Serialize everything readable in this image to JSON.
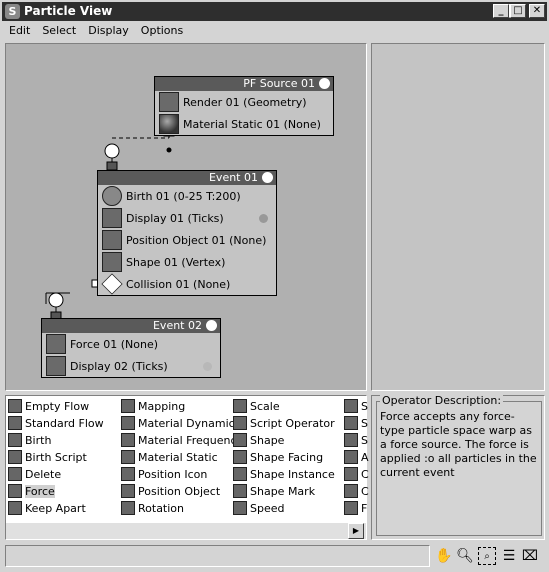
{
  "window": {
    "title": "Particle View"
  },
  "menu": [
    "Edit",
    "Select",
    "Display",
    "Options"
  ],
  "nodes": {
    "source": {
      "title": "PF Source 01",
      "rows": [
        "Render 01 (Geometry)",
        "Material Static 01 (None)"
      ]
    },
    "event1": {
      "title": "Event 01",
      "rows": [
        "Birth 01 (0-25 T:200)",
        "Display 01 (Ticks)",
        "Position Object 01 (None)",
        "Shape 01 (Vertex)",
        "Collision 01 (None)"
      ]
    },
    "event2": {
      "title": "Event 02",
      "rows": [
        "Force 01 (None)",
        "Display 02 (Ticks)"
      ]
    }
  },
  "depot": {
    "col1": [
      "Empty Flow",
      "Standard Flow",
      "Birth",
      "Birth Script",
      "Delete",
      "Force",
      "Keep Apart"
    ],
    "col2": [
      "Mapping",
      "Material Dynamic",
      "Material Frequency",
      "Material Static",
      "Position Icon",
      "Position Object",
      "Rotation"
    ],
    "col3": [
      "Scale",
      "Script Operator",
      "Shape",
      "Shape Facing",
      "Shape Instance",
      "Shape Mark",
      "Speed"
    ],
    "col4": [
      "S",
      "S",
      "S",
      "A",
      "C",
      "C",
      "F"
    ],
    "selected": "Force"
  },
  "description": {
    "label": "Operator Description:",
    "text": "Force accepts any force-type particle space warp as a force source. The force is applied :o all particles in the current event"
  },
  "tools": [
    "pan-icon",
    "zoom-icon",
    "zoom-region-icon",
    "zoom-extents-icon",
    "no-zoom-icon"
  ]
}
